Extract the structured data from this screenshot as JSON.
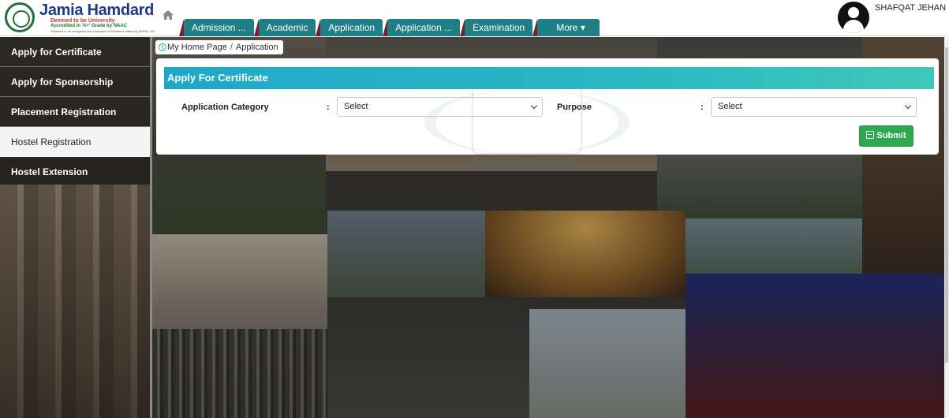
{
  "header": {
    "logo": {
      "name": "Jamia Hamdard",
      "tagline": "Deemed to be University",
      "accreditation": "Accredited in 'A+' Grade by NAAC",
      "subline": "Declared to be designated as Institution of Eminence status by MHRD, GoI"
    },
    "home_icon": "home-icon",
    "nav_tabs": [
      {
        "label": "Admission ..."
      },
      {
        "label": "Academic"
      },
      {
        "label": "Application"
      },
      {
        "label": "Application ..."
      },
      {
        "label": "Examination"
      },
      {
        "label": "More ▾"
      }
    ],
    "user": {
      "name": "SHAFQAT JEHAN",
      "avatar_icon": "user-avatar-icon"
    }
  },
  "sidebar": {
    "items": [
      {
        "label": "Apply for Certificate"
      },
      {
        "label": "Apply for Sponsorship"
      },
      {
        "label": "Placement Registration"
      },
      {
        "label": "Hostel Registration",
        "active": true
      },
      {
        "label": "Hostel Extension"
      }
    ]
  },
  "breadcrumb": {
    "home": "My Home Page",
    "separator": "/",
    "current": "Application"
  },
  "form": {
    "title": "Apply For Certificate",
    "fields": [
      {
        "label": "Application Category",
        "colon": ":",
        "value": "Select"
      },
      {
        "label": "Purpose",
        "colon": ":",
        "value": "Select"
      }
    ],
    "submit_label": "Submit",
    "submit_icon": "save-icon"
  },
  "colors": {
    "nav_tab": "#1f7f86",
    "panel_header": "#1ea8c8",
    "submit": "#2fa84f",
    "logo_blue": "#1b3a8c"
  }
}
